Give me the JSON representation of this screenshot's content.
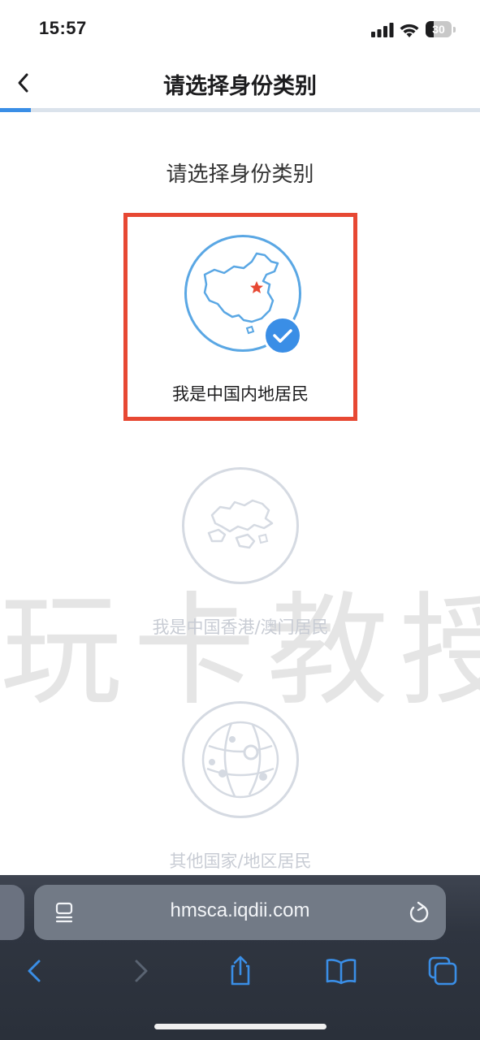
{
  "status_bar": {
    "time": "15:57",
    "battery": "30",
    "battery_level": 0.3
  },
  "header": {
    "title": "请选择身份类别",
    "progress": 0.064
  },
  "section_title": "请选择身份类别",
  "options": [
    {
      "label": "我是中国内地居民",
      "selected": true,
      "icon": "china-map-icon"
    },
    {
      "label": "我是中国香港/澳门居民",
      "selected": false,
      "icon": "hong-kong-map-icon"
    },
    {
      "label": "其他国家/地区居民",
      "selected": false,
      "icon": "globe-network-icon"
    }
  ],
  "watermark": "玩卡教授",
  "browser": {
    "url": "hmsca.iqdii.com"
  },
  "colors": {
    "accent": "#3a8ee6",
    "highlight": "#e74833",
    "disabled": "#c8ccd4"
  }
}
